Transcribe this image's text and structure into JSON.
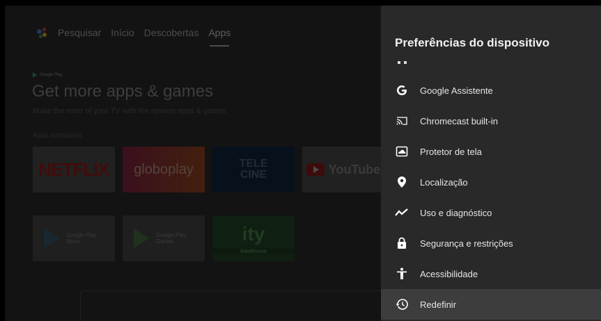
{
  "background": {
    "nav": {
      "items": [
        "Pesquisar",
        "Início",
        "Descobertas",
        "Apps"
      ],
      "active": "Apps"
    },
    "hero": {
      "badge": "Google Play",
      "title": "Get more apps & games",
      "subtitle": "Make the most of your TV with the newest apps & games"
    },
    "installed_label": "Apps instalados",
    "apps_row1": [
      "NETFLIX",
      "globoplay",
      "TELE CINE",
      "YouTube"
    ],
    "apps_row2": [
      {
        "name": "Google Play",
        "sub": "Store"
      },
      {
        "name": "Google Play",
        "sub": "Games"
      },
      {
        "name": "ity",
        "sub": "Intellivros"
      }
    ]
  },
  "panel": {
    "title": "Preferências do dispositivo",
    "items": [
      {
        "label": "Google Assistente",
        "icon": "google-g-icon"
      },
      {
        "label": "Chromecast built-in",
        "icon": "cast-icon"
      },
      {
        "label": "Protetor de tela",
        "icon": "screensaver-icon"
      },
      {
        "label": "Localização",
        "icon": "location-pin-icon"
      },
      {
        "label": "Uso e diagnóstico",
        "icon": "trend-icon"
      },
      {
        "label": "Segurança e restrições",
        "icon": "lock-icon"
      },
      {
        "label": "Acessibilidade",
        "icon": "accessibility-icon"
      },
      {
        "label": "Redefinir",
        "icon": "history-icon"
      }
    ],
    "focused_item": "Redefinir"
  }
}
